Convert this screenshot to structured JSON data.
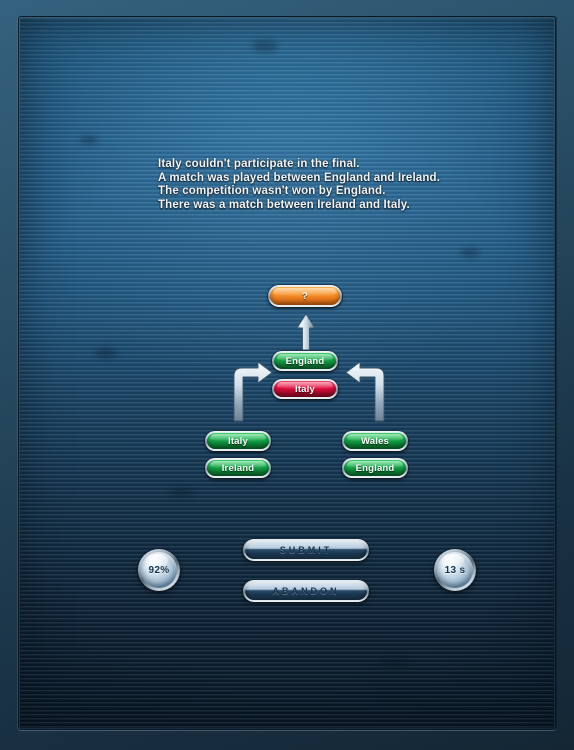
{
  "clues": {
    "lines": [
      "Italy couldn't participate in the final.",
      "A match was played between England and Ireland.",
      "The competition wasn't won by England.",
      "There was a match between Ireland and Italy."
    ]
  },
  "bracket": {
    "final_slot": {
      "label": "?",
      "state": "unknown",
      "color": "#f7912a"
    },
    "semifinal_slots": [
      {
        "label": "England",
        "state": "selected",
        "color": "#16a94a"
      },
      {
        "label": "Italy",
        "state": "eliminated",
        "color": "#df0f3e"
      }
    ],
    "quarterfinal_left": [
      {
        "label": "Italy",
        "state": "available",
        "color": "#16a94a"
      },
      {
        "label": "Ireland",
        "state": "available",
        "color": "#16a94a"
      }
    ],
    "quarterfinal_right": [
      {
        "label": "Wales",
        "state": "available",
        "color": "#16a94a"
      },
      {
        "label": "England",
        "state": "available",
        "color": "#16a94a"
      }
    ]
  },
  "actions": {
    "submit_label": "SUBMIT",
    "abandon_label": "ABANDON"
  },
  "status": {
    "score_label": "92%",
    "timer_label": "13 s"
  }
}
